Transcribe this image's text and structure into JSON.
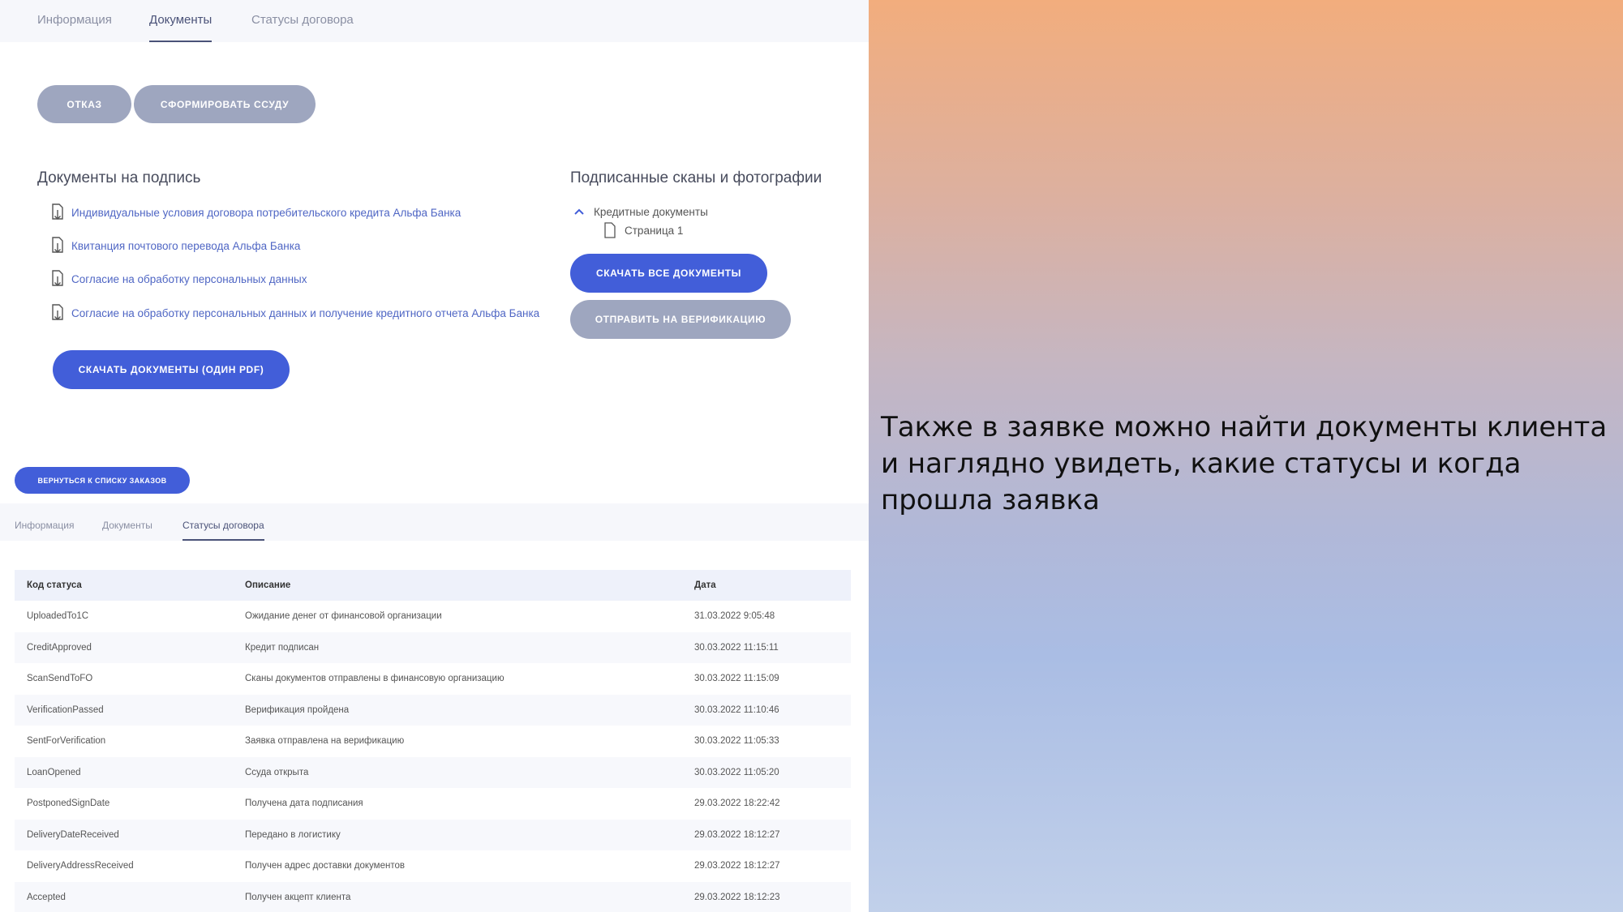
{
  "top_tabs": [
    "Информация",
    "Документы",
    "Статусы договора"
  ],
  "top_actions": {
    "reject": "ОТКАЗ",
    "form_loan": "СФОРМИРОВАТЬ ССУДУ"
  },
  "docs_to_sign": {
    "title": "Документы на подпись",
    "items": [
      "Индивидуальные условия договора потребительского кредита Альфа Банка",
      "Квитанция почтового перевода Альфа Банка",
      "Согласие на обработку персональных данных",
      "Согласие на обработку персональных данных и получение кредитного отчета Альфа Банка"
    ],
    "download_button": "СКАЧАТЬ ДОКУМЕНТЫ (ОДИН PDF)"
  },
  "signed_scans": {
    "title": "Подписанные сканы и фотографии",
    "group_label": "Кредитные документы",
    "page_label": "Страница 1",
    "download_all_button": "СКАЧАТЬ ВСЕ ДОКУМЕНТЫ",
    "send_verification_button": "ОТПРАВИТЬ НА ВЕРИФИКАЦИЮ"
  },
  "back_button": "ВЕРНУТЬСЯ К СПИСКУ ЗАКАЗОВ",
  "bottom_tabs": [
    "Информация",
    "Документы",
    "Статусы договора"
  ],
  "status_table": {
    "headers": [
      "Код статуса",
      "Описание",
      "Дата"
    ],
    "rows": [
      [
        "UploadedTo1C",
        "Ожидание денег от финансовой организации",
        "31.03.2022 9:05:48"
      ],
      [
        "CreditApproved",
        "Кредит подписан",
        "30.03.2022 11:15:11"
      ],
      [
        "ScanSendToFO",
        "Сканы документов отправлены в финансовую организацию",
        "30.03.2022 11:15:09"
      ],
      [
        "VerificationPassed",
        "Верификация пройдена",
        "30.03.2022 11:10:46"
      ],
      [
        "SentForVerification",
        "Заявка отправлена на верификацию",
        "30.03.2022 11:05:33"
      ],
      [
        "LoanOpened",
        "Ссуда открыта",
        "30.03.2022 11:05:20"
      ],
      [
        "PostponedSignDate",
        "Получена дата подписания",
        "29.03.2022 18:22:42"
      ],
      [
        "DeliveryDateReceived",
        "Передано в логистику",
        "29.03.2022 18:12:27"
      ],
      [
        "DeliveryAddressReceived",
        "Получен адрес доставки документов",
        "29.03.2022 18:12:27"
      ],
      [
        "Accepted",
        "Получен акцепт клиента",
        "29.03.2022 18:12:23"
      ]
    ]
  },
  "caption": "Также в заявке можно найти документы клиента и наглядно увидеть, какие статусы и когда прошла заявка",
  "colors": {
    "accent_blue": "#425ed9",
    "disabled_grey": "#9ea6bf",
    "link": "#4f66c4"
  }
}
